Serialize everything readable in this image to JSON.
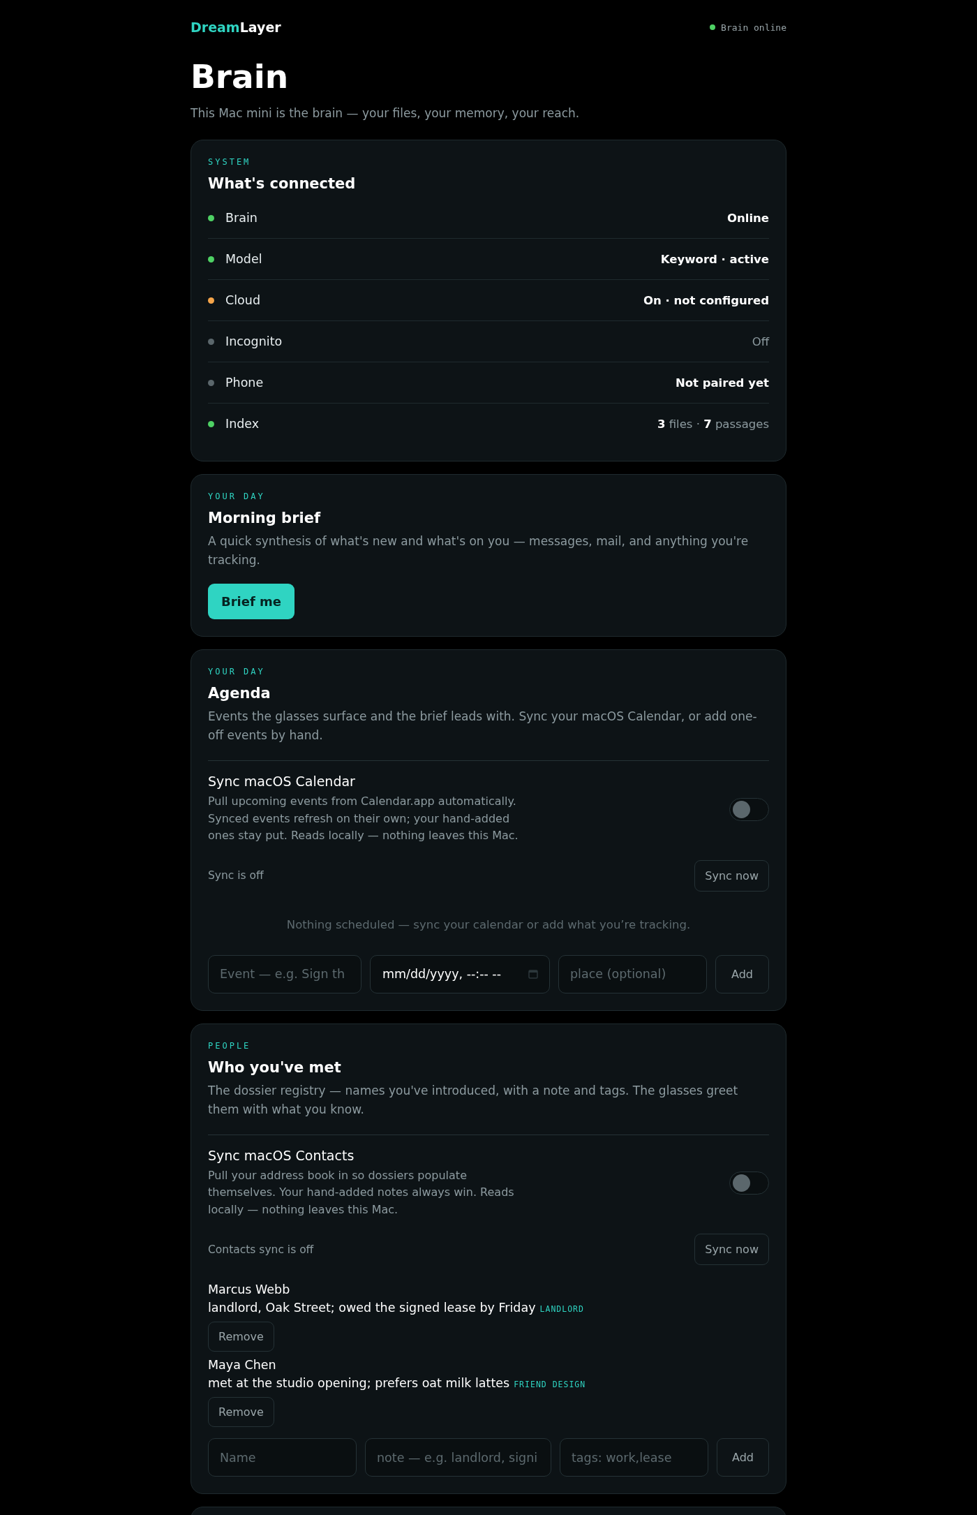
{
  "header": {
    "logo_primary": "Dream",
    "logo_secondary": "Layer",
    "status": {
      "label": "Brain online",
      "color": "#4ed164"
    }
  },
  "page": {
    "title": "Brain",
    "subtitle": "This Mac mini is the brain — your files, your memory, your reach."
  },
  "system": {
    "eyebrow": "SYSTEM",
    "title": "What's connected",
    "items": [
      {
        "name": "Brain",
        "value": "Online",
        "color": "#4ed164",
        "muted": false
      },
      {
        "name": "Model",
        "value": "Keyword · active",
        "color": "#4ed164",
        "muted": false
      },
      {
        "name": "Cloud",
        "value": "On · not configured",
        "color": "#f5a54a",
        "muted": false
      },
      {
        "name": "Incognito",
        "value": "Off",
        "color": "#5b676c",
        "muted": true
      },
      {
        "name": "Phone",
        "value": "Not paired yet",
        "color": "#5b676c",
        "muted": false
      },
      {
        "name": "Index",
        "value": "**3** files · **7** passages",
        "color": "#4ed164",
        "muted": true
      }
    ]
  },
  "brief": {
    "eyebrow": "YOUR DAY",
    "title": "Morning brief",
    "description": "A quick synthesis of what's new and what's on you — messages, mail, and anything you're tracking.",
    "button": "Brief me"
  },
  "agenda": {
    "eyebrow": "YOUR DAY",
    "title": "Agenda",
    "description": "Events the glasses surface and the brief leads with. Sync your macOS Calendar, or add one-off events by hand.",
    "sync": {
      "title": "Sync macOS Calendar",
      "description": "Pull upcoming events from Calendar.app automatically. Synced events refresh on their own; your hand-added ones stay put. Reads locally — nothing leaves this Mac.",
      "on": false,
      "status": "Sync is off",
      "button": "Sync now"
    },
    "empty": "Nothing scheduled — sync your calendar or add what you’re tracking.",
    "form": {
      "event_placeholder": "Event — e.g. Sign th",
      "datetime": "mm/dd/yyyy, --:-- --",
      "place_placeholder": "place (optional)",
      "button": "Add"
    }
  },
  "people": {
    "eyebrow": "PEOPLE",
    "title": "Who you've met",
    "description": "The dossier registry — names you've introduced, with a note and tags. The glasses greet them with what you know.",
    "sync": {
      "title": "Sync macOS Contacts",
      "description": "Pull your address book in so dossiers populate themselves. Your hand-added notes always win. Reads locally — nothing leaves this Mac.",
      "on": false,
      "status": "Contacts sync is off",
      "button": "Sync now"
    },
    "contacts": [
      {
        "name": "Marcus Webb",
        "note": "landlord, Oak Street; owed the signed lease by Friday",
        "tags": "LANDLORD",
        "button": "Remove"
      },
      {
        "name": "Maya Chen",
        "note": "met at the studio opening; prefers oat milk lattes",
        "tags": "FRIEND DESIGN",
        "button": "Remove"
      }
    ],
    "form": {
      "name_placeholder": "Name",
      "note_placeholder": "note — e.g. landlord, signi",
      "tags_placeholder": "tags: work,lease",
      "button": "Add"
    }
  }
}
